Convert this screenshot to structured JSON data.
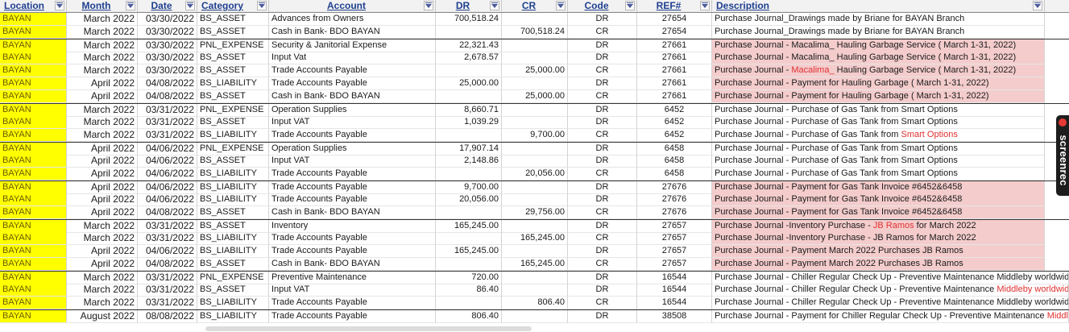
{
  "columns": [
    {
      "key": "location",
      "label": "Location"
    },
    {
      "key": "month",
      "label": "Month"
    },
    {
      "key": "date",
      "label": "Date"
    },
    {
      "key": "category",
      "label": "Category"
    },
    {
      "key": "account",
      "label": "Account"
    },
    {
      "key": "dr",
      "label": "DR"
    },
    {
      "key": "cr",
      "label": "CR"
    },
    {
      "key": "code",
      "label": "Code"
    },
    {
      "key": "ref",
      "label": "REF#"
    },
    {
      "key": "description",
      "label": "Description"
    }
  ],
  "rows": [
    {
      "location": "BAYAN",
      "month": "March 2022",
      "date": "03/30/2022",
      "category": "BS_ASSET",
      "account": "Advances from Owners",
      "dr": "700,518.24",
      "cr": "",
      "code": "DR",
      "ref": "27654",
      "desc": [
        {
          "t": "Purchase Journal_Drawings made by Briane for BAYAN Branch"
        }
      ],
      "hl": false,
      "sep": false
    },
    {
      "location": "BAYAN",
      "month": "March 2022",
      "date": "03/30/2022",
      "category": "BS_ASSET",
      "account": "Cash in Bank- BDO BAYAN",
      "dr": "",
      "cr": "700,518.24",
      "code": "CR",
      "ref": "27654",
      "desc": [
        {
          "t": "Purchase Journal_Drawings made by Briane for BAYAN Branch"
        }
      ],
      "hl": false,
      "sep": false
    },
    {
      "location": "BAYAN",
      "month": "March 2022",
      "date": "03/30/2022",
      "category": "PNL_EXPENSE",
      "account": "Security & Janitorial Expense",
      "dr": "22,321.43",
      "cr": "",
      "code": "DR",
      "ref": "27661",
      "desc": [
        {
          "t": "Purchase Journal - Macalima_ Hauling Garbage Service ( March 1-31, 2022)"
        }
      ],
      "hl": true,
      "sep": true
    },
    {
      "location": "BAYAN",
      "month": "March 2022",
      "date": "03/30/2022",
      "category": "BS_ASSET",
      "account": "Input Vat",
      "dr": "2,678.57",
      "cr": "",
      "code": "DR",
      "ref": "27661",
      "desc": [
        {
          "t": "Purchase Journal - Macalima_ Hauling Garbage Service ( March 1-31, 2022)"
        }
      ],
      "hl": true,
      "sep": false
    },
    {
      "location": "BAYAN",
      "month": "March 2022",
      "date": "03/30/2022",
      "category": "BS_ASSET",
      "account": "Trade Accounts Payable",
      "dr": "",
      "cr": "25,000.00",
      "code": "CR",
      "ref": "27661",
      "desc": [
        {
          "t": "Purchase Journal - "
        },
        {
          "t": "Macalima_",
          "red": true
        },
        {
          "t": " Hauling Garbage Service ( March 1-31, 2022)"
        }
      ],
      "hl": true,
      "sep": false
    },
    {
      "location": "BAYAN",
      "month": "April 2022",
      "date": "04/08/2022",
      "category": "BS_LIABILITY",
      "account": "Trade Accounts Payable",
      "dr": "25,000.00",
      "cr": "",
      "code": "DR",
      "ref": "27661",
      "desc": [
        {
          "t": "Purchase Journal - Payment for Hauling Garbage ( March 1-31, 2022)"
        }
      ],
      "hl": true,
      "sep": false
    },
    {
      "location": "BAYAN",
      "month": "April 2022",
      "date": "04/08/2022",
      "category": "BS_ASSET",
      "account": "Cash in Bank- BDO BAYAN",
      "dr": "",
      "cr": "25,000.00",
      "code": "CR",
      "ref": "27661",
      "desc": [
        {
          "t": "Purchase Journal - Payment for Hauling Garbage ( March 1-31, 2022)"
        }
      ],
      "hl": true,
      "sep": false
    },
    {
      "location": "BAYAN",
      "month": "March 2022",
      "date": "03/31/2022",
      "category": "PNL_EXPENSE",
      "account": "Operation Supplies",
      "dr": "8,660.71",
      "cr": "",
      "code": "DR",
      "ref": "6452",
      "desc": [
        {
          "t": "Purchase Journal - Purchase of Gas Tank from Smart Options"
        }
      ],
      "hl": false,
      "sep": true
    },
    {
      "location": "BAYAN",
      "month": "March 2022",
      "date": "03/31/2022",
      "category": "BS_ASSET",
      "account": "Input VAT",
      "dr": "1,039.29",
      "cr": "",
      "code": "DR",
      "ref": "6452",
      "desc": [
        {
          "t": "Purchase Journal - Purchase of Gas Tank from Smart Options"
        }
      ],
      "hl": false,
      "sep": false
    },
    {
      "location": "BAYAN",
      "month": "March 2022",
      "date": "03/31/2022",
      "category": "BS_LIABILITY",
      "account": "Trade Accounts Payable",
      "dr": "",
      "cr": "9,700.00",
      "code": "CR",
      "ref": "6452",
      "desc": [
        {
          "t": "Purchase Journal - Purchase of Gas Tank from "
        },
        {
          "t": "Smart Options",
          "red": true
        }
      ],
      "hl": false,
      "sep": false
    },
    {
      "location": "BAYAN",
      "month": "April 2022",
      "date": "04/06/2022",
      "category": "PNL_EXPENSE",
      "account": "Operation Supplies",
      "dr": "17,907.14",
      "cr": "",
      "code": "DR",
      "ref": "6458",
      "desc": [
        {
          "t": "Purchase Journal - Purchase of Gas Tank from Smart Options"
        }
      ],
      "hl": false,
      "sep": true
    },
    {
      "location": "BAYAN",
      "month": "April 2022",
      "date": "04/06/2022",
      "category": "BS_ASSET",
      "account": "Input VAT",
      "dr": "2,148.86",
      "cr": "",
      "code": "DR",
      "ref": "6458",
      "desc": [
        {
          "t": "Purchase Journal - Purchase of Gas Tank from Smart Options"
        }
      ],
      "hl": false,
      "sep": false
    },
    {
      "location": "BAYAN",
      "month": "April 2022",
      "date": "04/06/2022",
      "category": "BS_LIABILITY",
      "account": "Trade Accounts Payable",
      "dr": "",
      "cr": "20,056.00",
      "code": "CR",
      "ref": "6458",
      "desc": [
        {
          "t": "Purchase Journal - Purchase of Gas Tank from Smart Options"
        }
      ],
      "hl": false,
      "sep": false
    },
    {
      "location": "BAYAN",
      "month": "April 2022",
      "date": "04/06/2022",
      "category": "BS_LIABILITY",
      "account": "Trade Accounts Payable",
      "dr": "9,700.00",
      "cr": "",
      "code": "DR",
      "ref": "27676",
      "desc": [
        {
          "t": "Purchase Journal - Payment for Gas Tank  Invoice #6452&6458"
        }
      ],
      "hl": true,
      "sep": true
    },
    {
      "location": "BAYAN",
      "month": "April 2022",
      "date": "04/06/2022",
      "category": "BS_LIABILITY",
      "account": "Trade Accounts Payable",
      "dr": "20,056.00",
      "cr": "",
      "code": "DR",
      "ref": "27676",
      "desc": [
        {
          "t": "Purchase Journal - Payment for Gas Tank  Invoice #6452&6458"
        }
      ],
      "hl": true,
      "sep": false
    },
    {
      "location": "BAYAN",
      "month": "April 2022",
      "date": "04/08/2022",
      "category": "BS_ASSET",
      "account": "Cash in Bank- BDO BAYAN",
      "dr": "",
      "cr": "29,756.00",
      "code": "CR",
      "ref": "27676",
      "desc": [
        {
          "t": "Purchase Journal - Payment for Gas Tank  Invoice #6452&6458"
        }
      ],
      "hl": true,
      "sep": false
    },
    {
      "location": "BAYAN",
      "month": "March 2022",
      "date": "03/31/2022",
      "category": "BS_ASSET",
      "account": "Inventory",
      "dr": "165,245.00",
      "cr": "",
      "code": "DR",
      "ref": "27657",
      "desc": [
        {
          "t": "Purchase Journal -Inventory Purchase - "
        },
        {
          "t": "JB Ramos",
          "red": true
        },
        {
          "t": " for March 2022"
        }
      ],
      "hl": true,
      "sep": true
    },
    {
      "location": "BAYAN",
      "month": "March 2022",
      "date": "03/31/2022",
      "category": "BS_LIABILITY",
      "account": "Trade Accounts Payable",
      "dr": "",
      "cr": "165,245.00",
      "code": "CR",
      "ref": "27657",
      "desc": [
        {
          "t": "Purchase Journal -Inventory Purchase - JB Ramos for March 2022"
        }
      ],
      "hl": true,
      "sep": false
    },
    {
      "location": "BAYAN",
      "month": "April 2022",
      "date": "04/06/2022",
      "category": "BS_LIABILITY",
      "account": "Trade Accounts Payable",
      "dr": "165,245.00",
      "cr": "",
      "code": "DR",
      "ref": "27657",
      "desc": [
        {
          "t": "Purchase Journal - Payment March 2022 Purchases JB Ramos"
        }
      ],
      "hl": true,
      "sep": false
    },
    {
      "location": "BAYAN",
      "month": "April 2022",
      "date": "04/08/2022",
      "category": "BS_ASSET",
      "account": "Cash in Bank- BDO BAYAN",
      "dr": "",
      "cr": "165,245.00",
      "code": "CR",
      "ref": "27657",
      "desc": [
        {
          "t": "Purchase Journal - Payment March 2022 Purchases JB Ramos"
        }
      ],
      "hl": true,
      "sep": false
    },
    {
      "location": "BAYAN",
      "month": "March 2022",
      "date": "03/31/2022",
      "category": "PNL_EXPENSE",
      "account": "Preventive Maintenance",
      "dr": "720.00",
      "cr": "",
      "code": "DR",
      "ref": "16544",
      "desc": [
        {
          "t": "Purchase Journal - Chiller Regular Check Up - Preventive Maintenance Middleby worldwide"
        }
      ],
      "hl": false,
      "sep": true,
      "ext": true
    },
    {
      "location": "BAYAN",
      "month": "March 2022",
      "date": "03/31/2022",
      "category": "BS_ASSET",
      "account": "Input VAT",
      "dr": "86.40",
      "cr": "",
      "code": "DR",
      "ref": "16544",
      "desc": [
        {
          "t": "Purchase Journal - Chiller Regular Check Up - Preventive Maintenance "
        },
        {
          "t": "Middleby worldwide",
          "red": true
        }
      ],
      "hl": false,
      "sep": false,
      "ext": true
    },
    {
      "location": "BAYAN",
      "month": "March 2022",
      "date": "03/31/2022",
      "category": "BS_LIABILITY",
      "account": "Trade Accounts Payable",
      "dr": "",
      "cr": "806.40",
      "code": "CR",
      "ref": "16544",
      "desc": [
        {
          "t": "Purchase Journal - Chiller Regular Check Up - Preventive Maintenance Middleby worldwide"
        }
      ],
      "hl": false,
      "sep": false,
      "ext": true
    },
    {
      "location": "BAYAN",
      "month": "August 2022",
      "date": "08/08/2022",
      "category": "BS_LIABILITY",
      "account": "Trade Accounts Payable",
      "dr": "806.40",
      "cr": "",
      "code": "DR",
      "ref": "38508",
      "desc": [
        {
          "t": "Purchase Journal - Payment for Chiller Regular Check Up - Preventive Maintenance "
        },
        {
          "t": "Middleb",
          "red": true
        }
      ],
      "hl": false,
      "sep": true,
      "ext": true
    }
  ],
  "watermark": {
    "text": "screenrec"
  },
  "colors": {
    "location_fill": "#ffff00",
    "highlight_fill": "#f4cccc",
    "accent_red": "#e03030",
    "header_text": "#1f3f8f"
  }
}
